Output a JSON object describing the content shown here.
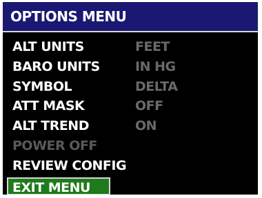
{
  "window": {
    "title": "OPTIONS MENU"
  },
  "menu": {
    "items": [
      {
        "label": "ALT UNITS",
        "value": "FEET",
        "enabled": true,
        "selected": false
      },
      {
        "label": "BARO UNITS",
        "value": "IN HG",
        "enabled": true,
        "selected": false
      },
      {
        "label": "SYMBOL",
        "value": "DELTA",
        "enabled": true,
        "selected": false
      },
      {
        "label": "ATT MASK",
        "value": "OFF",
        "enabled": true,
        "selected": false
      },
      {
        "label": "ALT TREND",
        "value": "ON",
        "enabled": true,
        "selected": false
      },
      {
        "label": "POWER OFF",
        "value": "",
        "enabled": false,
        "selected": false
      },
      {
        "label": "REVIEW CONFIG",
        "value": "",
        "enabled": true,
        "selected": false
      },
      {
        "label": "EXIT MENU",
        "value": "",
        "enabled": true,
        "selected": true
      }
    ]
  },
  "colors": {
    "title_bar": "#1b1873",
    "background": "#000000",
    "label_text": "#ffffff",
    "value_text": "#6a6a6a",
    "disabled_text": "#5a5a5a",
    "selection_highlight": "#1f7a1b",
    "border": "#d8d8d8"
  }
}
